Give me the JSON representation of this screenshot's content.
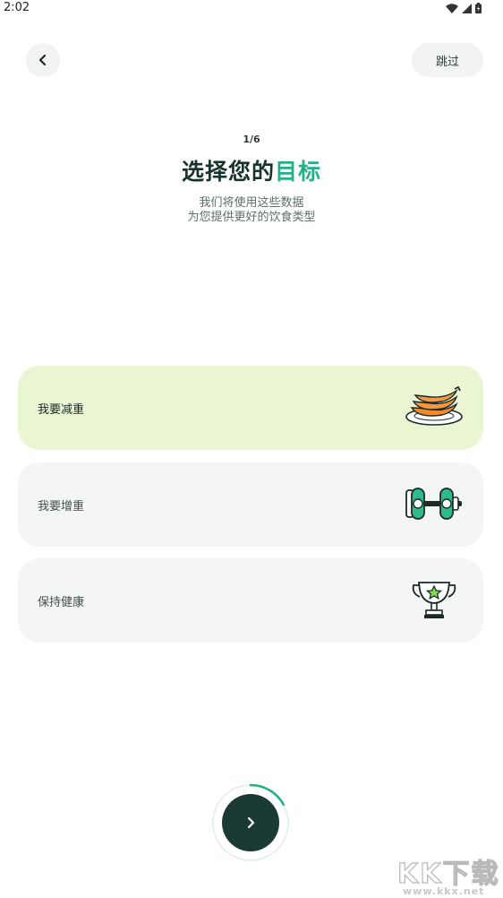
{
  "status_bar": {
    "time": "2:02"
  },
  "header": {
    "skip_label": "跳过"
  },
  "intro": {
    "step": "1/6",
    "title_main": "选择您的",
    "title_accent": "目标",
    "subtitle_line1": "我们将使用这些数据",
    "subtitle_line2": "为您提供更好的饮食类型"
  },
  "options": [
    {
      "label": "我要减重",
      "icon": "banana-plate-icon",
      "selected": true
    },
    {
      "label": "我要增重",
      "icon": "dumbbell-icon",
      "selected": false
    },
    {
      "label": "保持健康",
      "icon": "trophy-icon",
      "selected": false
    }
  ],
  "next": {
    "progress": 0.17
  },
  "watermark": {
    "text": "KK下载",
    "url": "www.kkx.net"
  },
  "colors": {
    "accent": "#25b088",
    "dark": "#1c3a35",
    "selected_bg": "#eaf5d4",
    "option_bg": "#f4f6f5"
  }
}
